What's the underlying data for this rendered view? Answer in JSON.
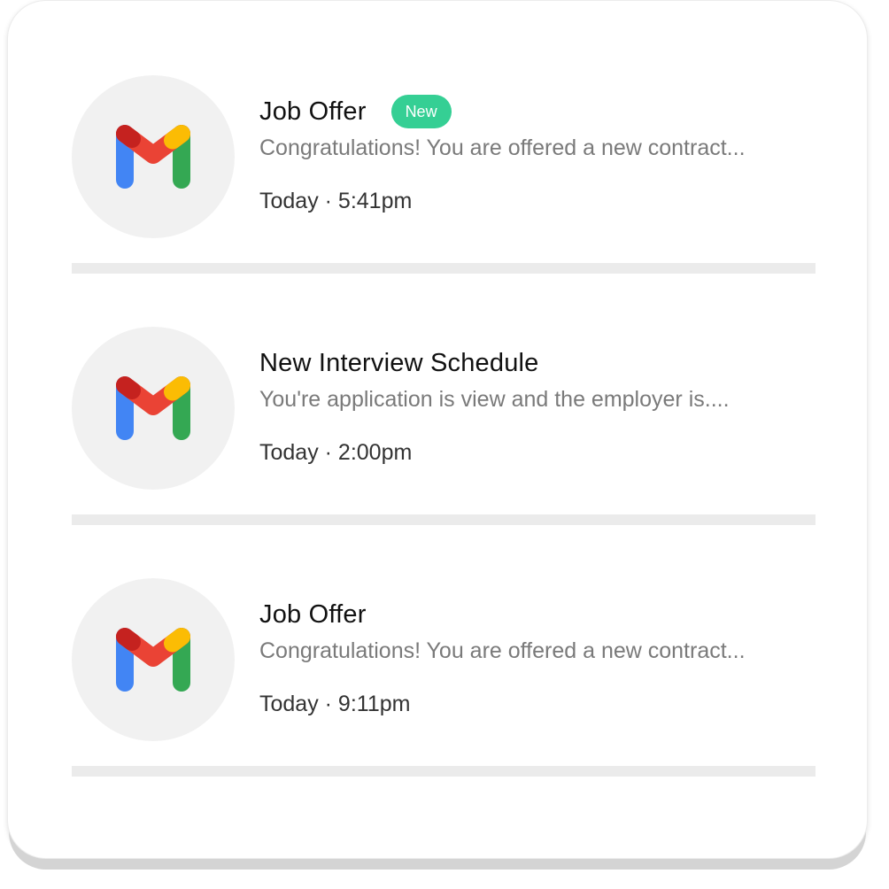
{
  "notifications": [
    {
      "title": "Job Offer",
      "badge": "New",
      "preview": "Congratulations! You are offered a new contract...",
      "time": "Today · 5:41pm",
      "icon": "gmail-icon"
    },
    {
      "title": "New Interview Schedule",
      "badge": "",
      "preview": "You're application is view and the employer is....",
      "time": "Today · 2:00pm",
      "icon": "gmail-icon"
    },
    {
      "title": "Job Offer",
      "badge": "",
      "preview": "Congratulations! You are offered a new contract...",
      "time": "Today · 9:11pm",
      "icon": "gmail-icon"
    }
  ],
  "colors": {
    "badge": "#35cf94",
    "avatar_bg": "#f1f1f1",
    "divider": "#ebebeb",
    "gmail_blue": "#4285f4",
    "gmail_red": "#ea4335",
    "gmail_yellow": "#fbbc04",
    "gmail_green": "#34a853",
    "gmail_dark_red": "#c5221f"
  }
}
